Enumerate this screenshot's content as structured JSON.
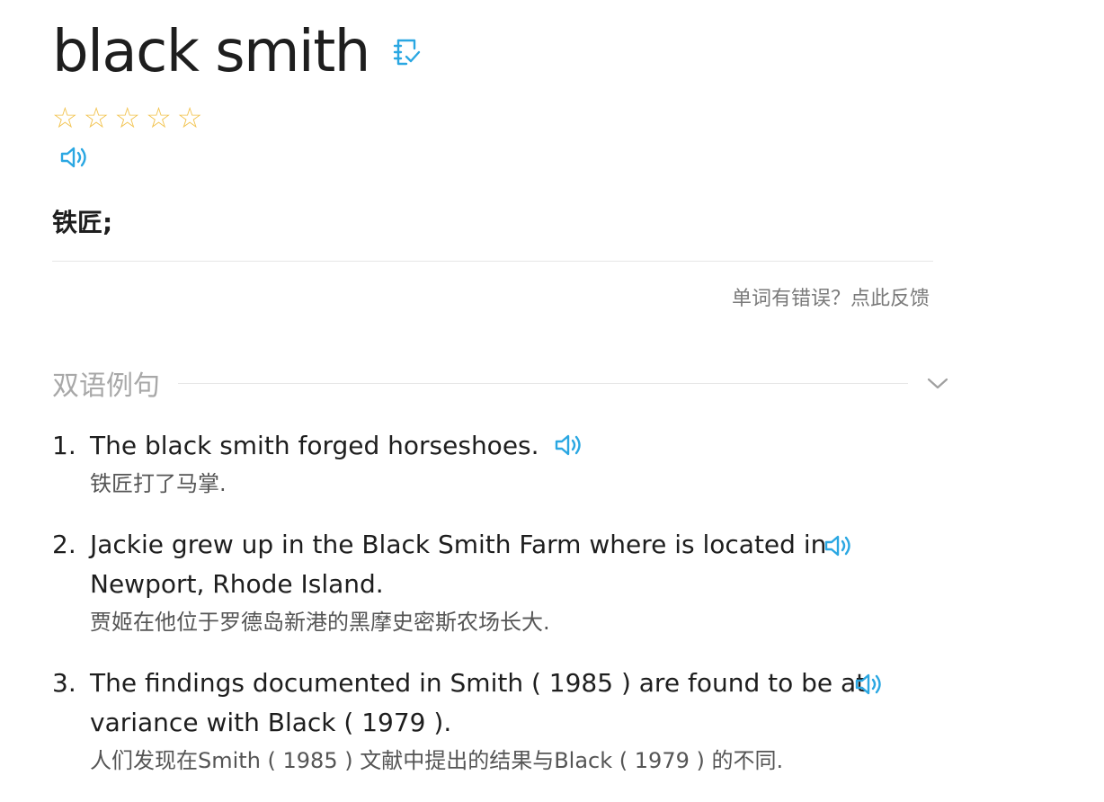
{
  "header": {
    "word": "black smith",
    "wordbook_icon": "wordbook-add-icon",
    "rating": {
      "max": 5,
      "value": 0,
      "star_char": "☆"
    },
    "pronunciation_icon": "speaker-icon"
  },
  "definition": {
    "meaning": "铁匠;"
  },
  "feedback": {
    "label": "单词有错误？点此反馈"
  },
  "examples_section": {
    "title": "双语例句",
    "toggle_icon": "chevron-down-icon"
  },
  "examples": [
    {
      "num": "1.",
      "en": "The black smith forged horseshoes.",
      "zh": "铁匠打了马掌."
    },
    {
      "num": "2.",
      "en": "Jackie grew up in the Black Smith Farm where is located in Newport, Rhode Island.",
      "zh": "贾姬在他位于罗德岛新港的黑摩史密斯农场长大."
    },
    {
      "num": "3.",
      "en": "The findings documented in Smith ( 1985 ) are found to be at variance with Black ( 1979 ).",
      "zh": "人们发现在Smith ( 1985 ) 文献中提出的结果与Black ( 1979 ) 的不同."
    }
  ],
  "colors": {
    "accent_blue": "#2aa7e2",
    "star_yellow": "#f2c34e",
    "text_primary": "#1e1e1e",
    "text_muted": "#a8a8a8"
  }
}
